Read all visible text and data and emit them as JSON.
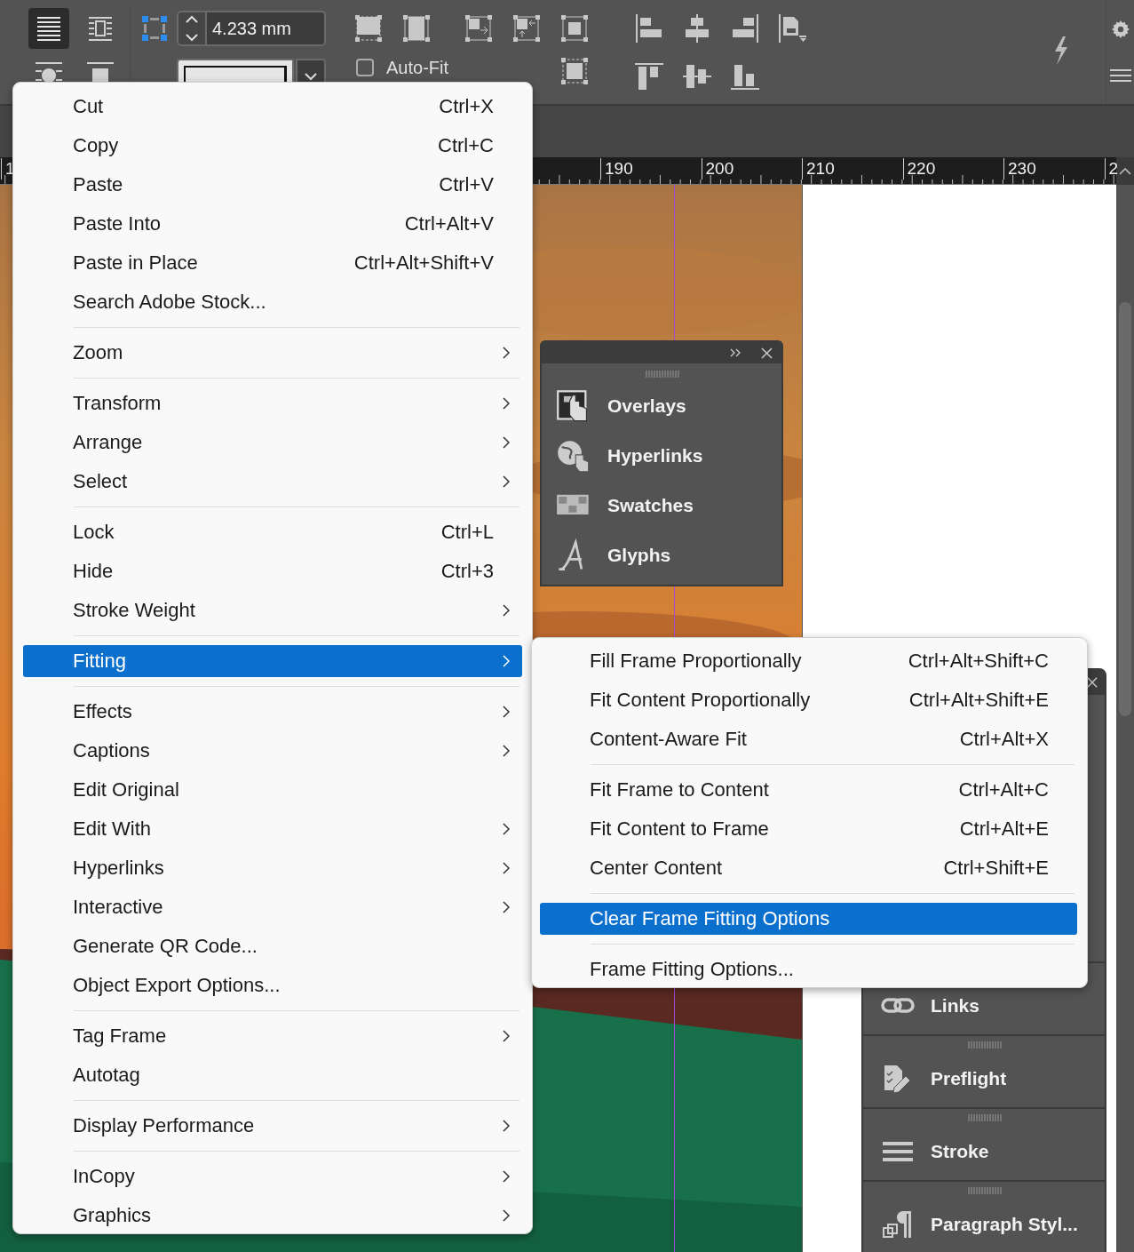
{
  "toolbar": {
    "wrap_buttons": [
      {
        "selected": true
      },
      {
        "selected": false
      },
      {
        "selected": false
      },
      {
        "selected": false
      }
    ],
    "offset_field": {
      "value": "4.233 mm"
    },
    "auto_fit": {
      "label": "Auto-Fit",
      "checked": false
    }
  },
  "ruler": {
    "labels": [
      "1",
      "190",
      "200",
      "210",
      "220",
      "230",
      "2"
    ]
  },
  "context_menu": {
    "groups": [
      [
        {
          "label": "Cut",
          "shortcut": "Ctrl+X",
          "submenu": false,
          "selected": false
        },
        {
          "label": "Copy",
          "shortcut": "Ctrl+C",
          "submenu": false,
          "selected": false
        },
        {
          "label": "Paste",
          "shortcut": "Ctrl+V",
          "submenu": false,
          "selected": false
        },
        {
          "label": "Paste Into",
          "shortcut": "Ctrl+Alt+V",
          "submenu": false,
          "selected": false
        },
        {
          "label": "Paste in Place",
          "shortcut": "Ctrl+Alt+Shift+V",
          "submenu": false,
          "selected": false
        },
        {
          "label": "Search Adobe Stock...",
          "submenu": false,
          "selected": false
        }
      ],
      [
        {
          "label": "Zoom",
          "submenu": true,
          "selected": false
        }
      ],
      [
        {
          "label": "Transform",
          "submenu": true,
          "selected": false
        },
        {
          "label": "Arrange",
          "submenu": true,
          "selected": false
        },
        {
          "label": "Select",
          "submenu": true,
          "selected": false
        }
      ],
      [
        {
          "label": "Lock",
          "shortcut": "Ctrl+L",
          "submenu": false,
          "selected": false
        },
        {
          "label": "Hide",
          "shortcut": "Ctrl+3",
          "submenu": false,
          "selected": false
        },
        {
          "label": "Stroke Weight",
          "submenu": true,
          "selected": false
        }
      ],
      [
        {
          "label": "Fitting",
          "submenu": true,
          "selected": true
        }
      ],
      [
        {
          "label": "Effects",
          "submenu": true,
          "selected": false
        },
        {
          "label": "Captions",
          "submenu": true,
          "selected": false
        },
        {
          "label": "Edit Original",
          "submenu": false,
          "selected": false
        },
        {
          "label": "Edit With",
          "submenu": true,
          "selected": false
        },
        {
          "label": "Hyperlinks",
          "submenu": true,
          "selected": false
        },
        {
          "label": "Interactive",
          "submenu": true,
          "selected": false
        },
        {
          "label": "Generate QR Code...",
          "submenu": false,
          "selected": false
        },
        {
          "label": "Object Export Options...",
          "submenu": false,
          "selected": false
        }
      ],
      [
        {
          "label": "Tag Frame",
          "submenu": true,
          "selected": false
        },
        {
          "label": "Autotag",
          "submenu": false,
          "selected": false
        }
      ],
      [
        {
          "label": "Display Performance",
          "submenu": true,
          "selected": false
        }
      ],
      [
        {
          "label": "InCopy",
          "submenu": true,
          "selected": false
        },
        {
          "label": "Graphics",
          "submenu": true,
          "selected": false
        }
      ]
    ]
  },
  "fitting_submenu": {
    "groups": [
      [
        {
          "label": "Fill Frame Proportionally",
          "shortcut": "Ctrl+Alt+Shift+C",
          "selected": false
        },
        {
          "label": "Fit Content Proportionally",
          "shortcut": "Ctrl+Alt+Shift+E",
          "selected": false
        },
        {
          "label": "Content-Aware Fit",
          "shortcut": "Ctrl+Alt+X",
          "selected": false
        }
      ],
      [
        {
          "label": "Fit Frame to Content",
          "shortcut": "Ctrl+Alt+C",
          "selected": false
        },
        {
          "label": "Fit Content to Frame",
          "shortcut": "Ctrl+Alt+E",
          "selected": false
        },
        {
          "label": "Center Content",
          "shortcut": "Ctrl+Shift+E",
          "selected": false
        }
      ],
      [
        {
          "label": "Clear Frame Fitting Options",
          "selected": true
        }
      ],
      [
        {
          "label": "Frame Fitting Options...",
          "selected": false
        }
      ]
    ]
  },
  "floating_panel": {
    "items": [
      {
        "kind": "touch",
        "label": "Overlays"
      },
      {
        "kind": "globe",
        "label": "Hyperlinks"
      },
      {
        "kind": "grid",
        "label": "Swatches"
      },
      {
        "kind": "glyph",
        "label": "Glyphs"
      }
    ]
  },
  "docked_panel": {
    "items": [
      {
        "kind": "chain",
        "label": "Links"
      },
      {
        "kind": "checklist",
        "label": "Preflight"
      },
      {
        "kind": "lines",
        "label": "Stroke"
      },
      {
        "kind": "pilcrow",
        "label": "Paragraph Styl..."
      }
    ]
  }
}
